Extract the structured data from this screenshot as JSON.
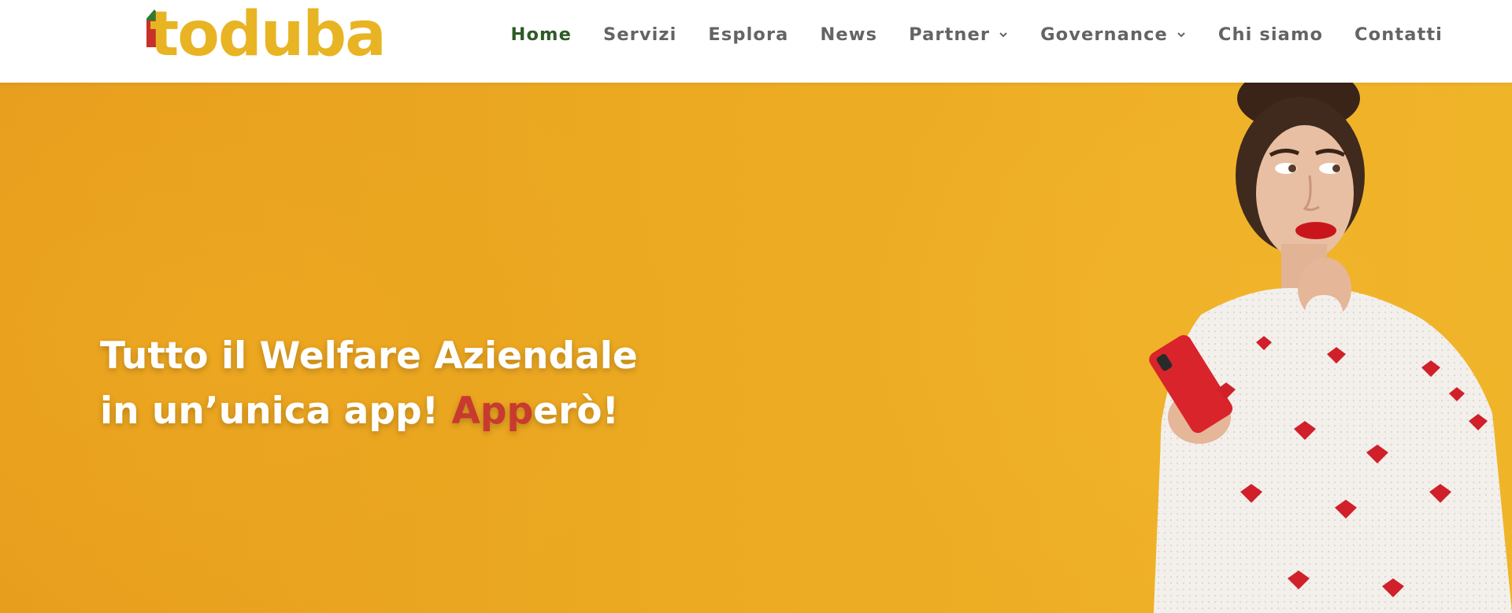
{
  "brand": {
    "name": "toduba",
    "colors": {
      "yellow": "#e8b423",
      "green": "#2f7a2e",
      "red": "#c8312a"
    }
  },
  "nav": {
    "items": [
      {
        "label": "Home",
        "active": true,
        "dropdown": false
      },
      {
        "label": "Servizi",
        "active": false,
        "dropdown": false
      },
      {
        "label": "Esplora",
        "active": false,
        "dropdown": false
      },
      {
        "label": "News",
        "active": false,
        "dropdown": false
      },
      {
        "label": "Partner",
        "active": false,
        "dropdown": true
      },
      {
        "label": "Governance",
        "active": false,
        "dropdown": true
      },
      {
        "label": "Chi siamo",
        "active": false,
        "dropdown": false
      },
      {
        "label": "Contatti",
        "active": false,
        "dropdown": false
      }
    ],
    "colors": {
      "default": "#666363",
      "active": "#2f5a26"
    }
  },
  "hero": {
    "line1": "Tutto il Welfare Aziendale",
    "line2_prefix": "in un’unica app! ",
    "line2_accent": "App",
    "line2_suffix": "erò!",
    "background": "#eba823",
    "accent_color": "#c83a2f",
    "image": "woman-with-red-phone-and-heart-sweater"
  }
}
